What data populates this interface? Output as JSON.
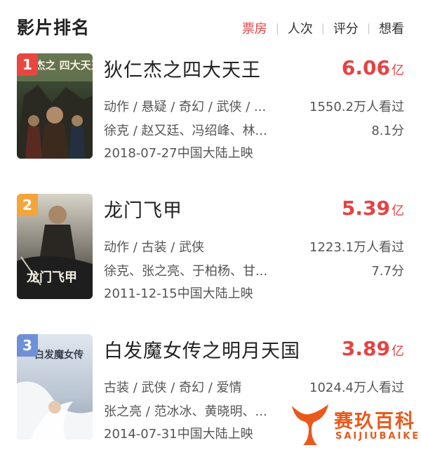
{
  "header": {
    "title": "影片排名",
    "tabs": [
      {
        "label": "票房",
        "active": true
      },
      {
        "label": "人次",
        "active": false
      },
      {
        "label": "评分",
        "active": false
      },
      {
        "label": "想看",
        "active": false
      }
    ]
  },
  "colors": {
    "accent": "#e54343",
    "rank1": "#e8473f",
    "rank2": "#f3a53c",
    "rank3": "#6f90d6"
  },
  "movies": [
    {
      "rank": "1",
      "title": "狄仁杰之四大天王",
      "box_office": "6.06",
      "box_unit": "亿",
      "genres": "动作 / 悬疑 / 奇幻 / 武侠 / ...",
      "viewers": "1550.2万人看过",
      "cast": "徐克 / 赵又廷、冯绍峰、林...",
      "rating": "8.1分",
      "release": "2018-07-27中国大陆上映",
      "poster_text": "狄仁杰之 四大天王"
    },
    {
      "rank": "2",
      "title": "龙门飞甲",
      "box_office": "5.39",
      "box_unit": "亿",
      "genres": "动作 / 古装 / 武侠",
      "viewers": "1223.1万人看过",
      "cast": "徐克、张之亮、于柏杨、甘...",
      "rating": "7.7分",
      "release": "2011-12-15中国大陆上映",
      "poster_text": "龙门飞甲"
    },
    {
      "rank": "3",
      "title": "白发魔女传之明月天国",
      "box_office": "3.89",
      "box_unit": "亿",
      "genres": "古装 / 武侠 / 奇幻 / 爱情",
      "viewers": "1024.4万人看过",
      "cast": "张之亮 / 范冰冰、黄晓明、...",
      "rating": "",
      "release": "2014-07-31中国大陆上映",
      "poster_text": "白发魔女传"
    }
  ],
  "watermark": {
    "cn": "赛玖百科",
    "en": "SAIJIUBAIKE"
  }
}
